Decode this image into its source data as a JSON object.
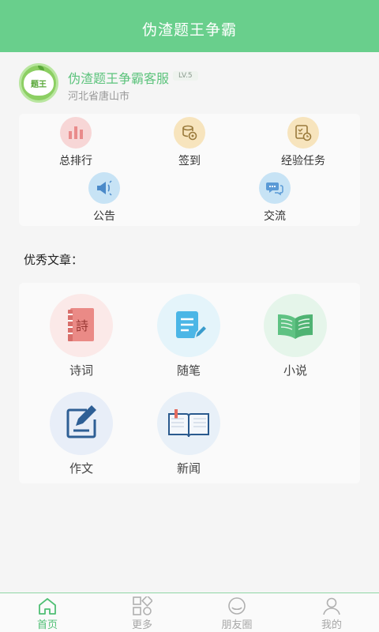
{
  "header": {
    "title": "伪渣题王争霸"
  },
  "profile": {
    "avatar_text": "题王",
    "name": "伪渣题王争霸客服",
    "level": "LV.5",
    "location": "河北省唐山市"
  },
  "menu": {
    "items": [
      {
        "label": "总排行",
        "icon": "bar-chart-icon",
        "bg": "#f7d6d6"
      },
      {
        "label": "签到",
        "icon": "coin-stack-icon",
        "bg": "#f7e4bd"
      },
      {
        "label": "经验任务",
        "icon": "task-clock-icon",
        "bg": "#f7e4bd"
      },
      {
        "label": "公告",
        "icon": "megaphone-icon",
        "bg": "#c7e3f5"
      },
      {
        "label": "交流",
        "icon": "chat-bubbles-icon",
        "bg": "#c7e3f5"
      }
    ]
  },
  "articles": {
    "section_title": "优秀文章：",
    "items": [
      {
        "label": "诗词",
        "icon": "poetry-book-icon",
        "bg": "#fbe9e8"
      },
      {
        "label": "随笔",
        "icon": "notepad-pen-icon",
        "bg": "#e4f4fa"
      },
      {
        "label": "小说",
        "icon": "open-book-icon",
        "bg": "#e5f5ea"
      },
      {
        "label": "作文",
        "icon": "edit-document-icon",
        "bg": "#e8eef8"
      },
      {
        "label": "新闻",
        "icon": "news-book-icon",
        "bg": "#e8f0f8"
      }
    ]
  },
  "tabs": [
    {
      "label": "首页",
      "icon": "home-icon",
      "active": true
    },
    {
      "label": "更多",
      "icon": "grid-icon",
      "active": false
    },
    {
      "label": "朋友圈",
      "icon": "moments-icon",
      "active": false
    },
    {
      "label": "我的",
      "icon": "user-icon",
      "active": false
    }
  ],
  "colors": {
    "primary": "#69cf8c",
    "accent_text": "#5cc37c",
    "active_tab": "#4fbf74"
  }
}
